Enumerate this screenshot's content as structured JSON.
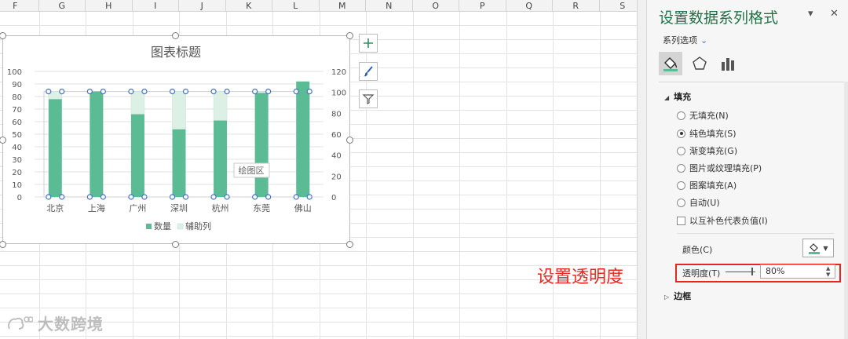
{
  "columns": [
    "F",
    "G",
    "H",
    "I",
    "J",
    "K",
    "L",
    "M",
    "N",
    "O",
    "P",
    "Q",
    "R",
    "S"
  ],
  "chart": {
    "title": "图表标题",
    "categories": [
      "北京",
      "上海",
      "广州",
      "深圳",
      "杭州",
      "东莞",
      "佛山"
    ],
    "left_axis_ticks": [
      "100",
      "90",
      "80",
      "70",
      "60",
      "50",
      "40",
      "30",
      "20",
      "10",
      "0"
    ],
    "right_axis_ticks": [
      "120",
      "100",
      "80",
      "60",
      "40",
      "20",
      "0"
    ],
    "legend": [
      "数量",
      "辅助列"
    ],
    "tooltip": "绘图区",
    "colors": {
      "main": "#5bbb94",
      "aux": "#dcf0e6"
    }
  },
  "chart_data": {
    "type": "bar",
    "categories": [
      "北京",
      "上海",
      "广州",
      "深圳",
      "杭州",
      "东莞",
      "佛山"
    ],
    "series": [
      {
        "name": "数量",
        "values": [
          78,
          84,
          66,
          54,
          61,
          83,
          92
        ]
      },
      {
        "name": "辅助列",
        "values": [
          6,
          0,
          18,
          30,
          23,
          1,
          0
        ]
      }
    ],
    "title": "图表标题",
    "ylim": [
      0,
      100
    ],
    "y2lim": [
      0,
      120
    ],
    "legend_position": "bottom",
    "grid": true
  },
  "annotation": "设置透明度",
  "watermark": "大数跨境",
  "pane": {
    "title": "设置数据系列格式",
    "series_options": "系列选项",
    "fill_section": "填充",
    "fill_options": [
      {
        "label": "无填充(N)",
        "selected": false
      },
      {
        "label": "纯色填充(S)",
        "selected": true
      },
      {
        "label": "渐变填充(G)",
        "selected": false
      },
      {
        "label": "图片或纹理填充(P)",
        "selected": false
      },
      {
        "label": "图案填充(A)",
        "selected": false
      },
      {
        "label": "自动(U)",
        "selected": false
      }
    ],
    "invert_label": "以互补色代表负值(I)",
    "color_label": "颜色(C)",
    "transparency_label": "透明度(T)",
    "transparency_value": "80%",
    "border_section": "边框"
  }
}
